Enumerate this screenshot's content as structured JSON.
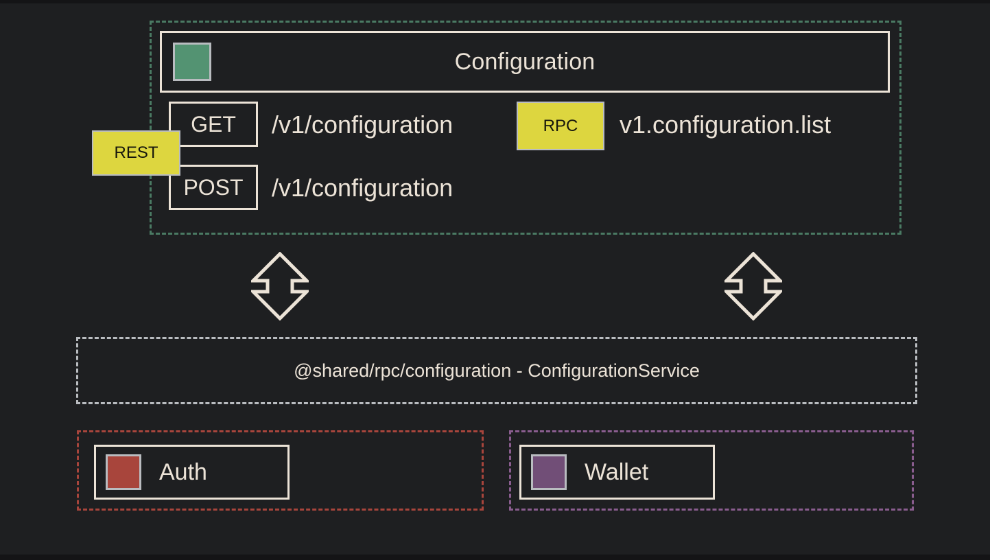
{
  "colors": {
    "background": "#1e1f21",
    "text": "#ece3d7",
    "service_green": "#539372",
    "service_red": "#a8453c",
    "service_purple": "#714e77",
    "tag_yellow": "#ddd63f",
    "group_green_border": "#4a7a63",
    "group_gray_border": "#b9bcc0",
    "group_red_border": "#a8453c",
    "group_purple_border": "#8a5d8f",
    "panel_border": "#ece3d7",
    "square_border": "#b9bcc0"
  },
  "configuration_group": {
    "name": "configuration-service-group",
    "service": {
      "title": "Configuration",
      "icon": "green-square-icon"
    },
    "rest": {
      "tag": "REST",
      "routes": [
        {
          "method": "GET",
          "path": "/v1/configuration"
        },
        {
          "method": "POST",
          "path": "/v1/configuration"
        }
      ]
    },
    "rpc": {
      "tag": "RPC",
      "procedures": [
        {
          "name": "v1.configuration.list"
        }
      ]
    }
  },
  "connectors": [
    {
      "name": "configuration-to-shared-arrow-left",
      "icon": "double-arrow-vertical-icon"
    },
    {
      "name": "configuration-to-shared-arrow-right",
      "icon": "double-arrow-vertical-icon"
    }
  ],
  "shared_band": {
    "name": "shared-rpc-band",
    "label": "@shared/rpc/configuration - ConfigurationService"
  },
  "consumers": [
    {
      "name": "auth-group",
      "title": "Auth",
      "icon": "red-square-icon",
      "color": "#a8453c",
      "border": "#a8453c"
    },
    {
      "name": "wallet-group",
      "title": "Wallet",
      "icon": "purple-square-icon",
      "color": "#714e77",
      "border": "#8a5d8f"
    }
  ]
}
